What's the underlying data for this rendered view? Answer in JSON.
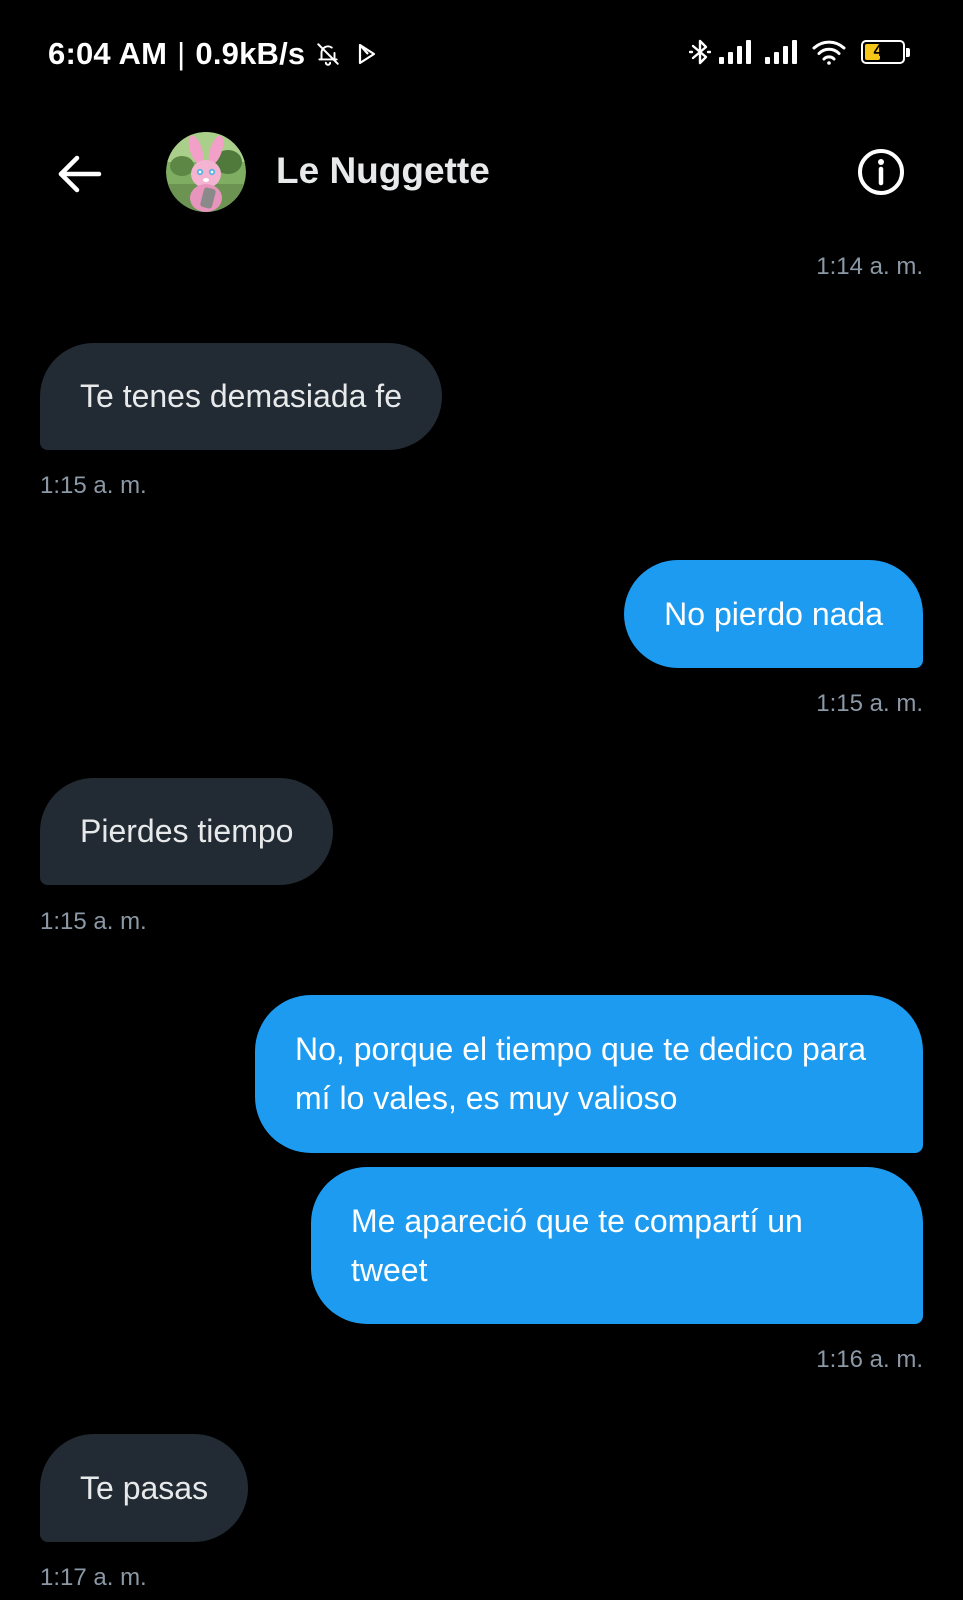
{
  "status_bar": {
    "time": "6:04 AM",
    "separator": "|",
    "network_speed": "0.9kB/s",
    "battery_level": "42",
    "battery_fraction": 0.42,
    "battery_color": "#f5c518",
    "icons": [
      "bell-off-icon",
      "play-store-icon",
      "bluetooth-icon",
      "signal-icon",
      "signal-icon",
      "wifi-icon",
      "battery-icon"
    ]
  },
  "header": {
    "back_icon": "arrow-left-icon",
    "contact_name": "Le Nuggette",
    "info_icon": "info-circle-icon"
  },
  "colors": {
    "background": "#000000",
    "incoming_bubble": "#222b33",
    "outgoing_bubble": "#1d9bf0",
    "timestamp": "#8b98a5",
    "text": "#e7e9ea"
  },
  "messages": [
    {
      "direction": "outgoing_timestamp_only",
      "time": "1:14 a. m."
    },
    {
      "direction": "incoming",
      "text": "Te tenes demasiada fe",
      "time": "1:15 a. m."
    },
    {
      "direction": "outgoing",
      "text": "No pierdo nada",
      "time": "1:15 a. m."
    },
    {
      "direction": "incoming",
      "text": "Pierdes tiempo",
      "time": "1:15 a. m."
    },
    {
      "direction": "outgoing",
      "text": "No, porque el tiempo que te dedico para mí lo vales, es muy valioso"
    },
    {
      "direction": "outgoing",
      "text": "Me apareció que te compartí un tweet",
      "time": "1:16 a. m."
    },
    {
      "direction": "incoming",
      "text": "Te pasas",
      "time": "1:17 a. m."
    }
  ]
}
